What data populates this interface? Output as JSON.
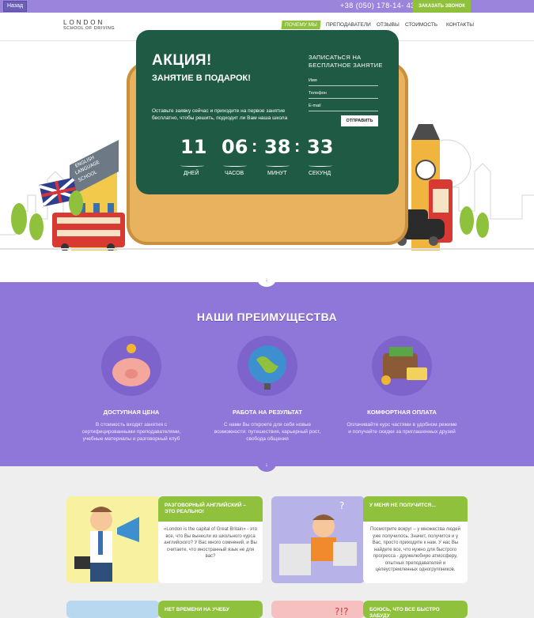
{
  "topbar": {
    "back_label": "Назад",
    "phone": "+38 (050) 178-14- 43",
    "call_button": "ЗАКАЗАТЬ ЗВОНОК"
  },
  "logo": {
    "line1": "LONDON",
    "line2": "SCHOOL OF DRIVING"
  },
  "nav": [
    "ПОЧЕМУ МЫ",
    "ПРЕПОДАВАТЕЛИ",
    "ОТЗЫВЫ",
    "СТОИМОСТЬ",
    "КОНТАКТЫ"
  ],
  "hero": {
    "title": "АКЦИЯ!",
    "subtitle": "ЗАНЯТИЕ В ПОДАРОК!",
    "text": "Оставьте заявку сейчас и приходите на первое занятие бесплатно, чтобы решить, подходит ли Вам наша школа",
    "school_sign": "ENGLISH LANGUAGE SCHOOL",
    "countdown": {
      "days": "11",
      "hours": "06",
      "minutes": "38",
      "seconds": "33",
      "days_label": "ДНЕЙ",
      "hours_label": "ЧАСОВ",
      "minutes_label": "МИНУТ",
      "seconds_label": "СЕКУНД"
    },
    "form": {
      "title_line1": "ЗАПИСАТЬСЯ НА",
      "title_line2": "БЕСПЛАТНОЕ ЗАНЯТИЕ",
      "name_placeholder": "Имя",
      "phone_placeholder": "Телефон",
      "email_placeholder": "E-mail",
      "submit": "ОТПРАВИТЬ"
    }
  },
  "advantages": {
    "title": "НАШИ ПРЕИМУЩЕСТВА",
    "items": [
      {
        "name": "ДОСТУПНАЯ ЦЕНА",
        "desc": "В стоимость входят занятия с сертифицированными преподавателями, учебные материалы и разговорный клуб",
        "icon": "piggy-bank-icon"
      },
      {
        "name": "РАБОТА НА РЕЗУЛЬТАТ",
        "desc": "С нами Вы откроете для себя новые возможности: путешествия, карьерный рост, свобода общения",
        "icon": "globe-icon"
      },
      {
        "name": "КОМФОРТНАЯ ОПЛАТА",
        "desc": "Оплачивайте курс частями в удобном режиме и получайте скидки за приглашенных друзей",
        "icon": "wallet-icon"
      }
    ]
  },
  "cards": [
    {
      "title": "РАЗГОВОРНЫЙ АНГЛИЙСКИЙ – ЭТО РЕАЛЬНО!",
      "text": "«London is the capital of Great Britain» - это все, что Вы вынесли из школьного курса английского? У Вас много сомнений, и Вы считаете, что иностранный язык не для вас?"
    },
    {
      "title": "У МЕНЯ НЕ ПОЛУЧИТСЯ...",
      "text": "Посмотрите вокруг – у множества людей уже получилось. Значит, получится и у Вас, просто приходите к нам. У нас Вы найдете все, что нужно для быстрого прогресса - дружелюбную атмосферу, опытных преподавателей и целеустремленных одногруппников."
    },
    {
      "title": "НЕТ ВРЕМЕНИ НА УЧЕБУ",
      "text": ""
    },
    {
      "title": "БОЮСЬ, ЧТО ВСЕ БЫСТРО ЗАБУДУ",
      "text": ""
    }
  ],
  "colors": {
    "purple": "#8f77d9",
    "green": "#8fc13c",
    "board": "#1f5a45",
    "frame": "#e9b25e"
  }
}
